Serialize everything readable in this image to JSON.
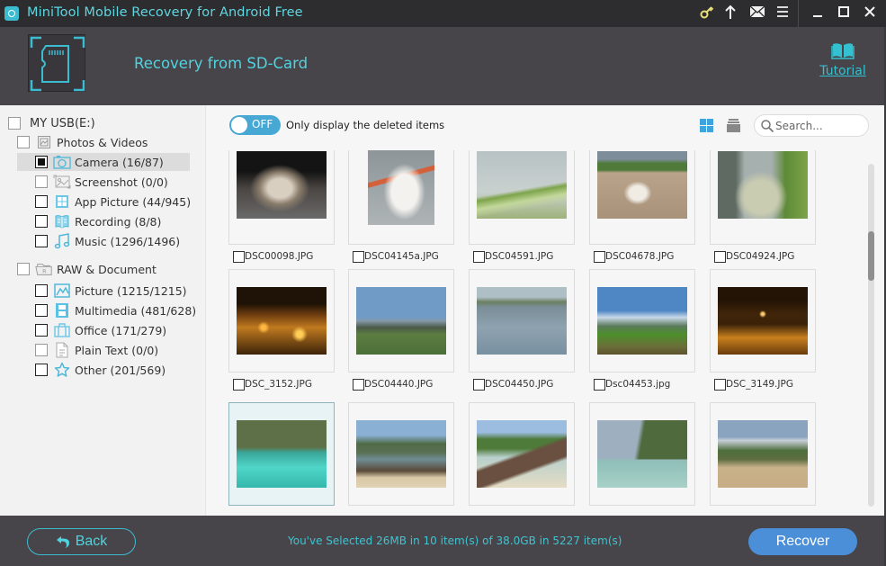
{
  "window": {
    "title": "MiniTool Mobile Recovery for Android Free",
    "icons": [
      "key-icon",
      "upgrade-arrow-icon",
      "mail-icon",
      "menu-icon",
      "minimize-icon",
      "maximize-icon",
      "close-icon"
    ]
  },
  "header": {
    "title": "Recovery from SD-Card",
    "tutorial_label": "Tutorial"
  },
  "sidebar": {
    "root": {
      "label": "MY USB(E:)",
      "checked": false
    },
    "groups": [
      {
        "label": "Photos & Videos",
        "icon": "photo-folder-icon",
        "items": [
          {
            "label": "Camera (16/87)",
            "icon": "camera-icon",
            "checked": true,
            "selected": true
          },
          {
            "label": "Screenshot (0/0)",
            "icon": "screenshot-icon",
            "checked": false,
            "disabled": true
          },
          {
            "label": "App Picture (44/945)",
            "icon": "app-picture-icon",
            "checked": false
          },
          {
            "label": "Recording (8/8)",
            "icon": "recording-icon",
            "checked": false
          },
          {
            "label": "Music (1296/1496)",
            "icon": "music-icon",
            "checked": false
          }
        ]
      },
      {
        "label": "RAW & Document",
        "icon": "raw-folder-icon",
        "items": [
          {
            "label": "Picture (1215/1215)",
            "icon": "picture-icon",
            "checked": false
          },
          {
            "label": "Multimedia (481/628)",
            "icon": "multimedia-icon",
            "checked": false
          },
          {
            "label": "Office (171/279)",
            "icon": "office-icon",
            "checked": false
          },
          {
            "label": "Plain Text (0/0)",
            "icon": "plain-text-icon",
            "checked": false,
            "disabled": true
          },
          {
            "label": "Other (201/569)",
            "icon": "other-star-icon",
            "checked": false
          }
        ]
      }
    ]
  },
  "toolbar": {
    "toggle_state": "OFF",
    "toggle_caption": "Only display the deleted items",
    "search_placeholder": "Search..."
  },
  "files": [
    {
      "name": "DSC00098.JPG",
      "thumb": "cat"
    },
    {
      "name": "DSC04145a.JPG",
      "thumb": "stork"
    },
    {
      "name": "DSC04591.JPG",
      "thumb": "dragonfly"
    },
    {
      "name": "DSC04678.JPG",
      "thumb": "dog-beach"
    },
    {
      "name": "DSC04924.JPG",
      "thumb": "butterfly"
    },
    {
      "name": "DSC_3152.JPG",
      "thumb": "city-night"
    },
    {
      "name": "DSC04440.JPG",
      "thumb": "mountain-field"
    },
    {
      "name": "DSC04450.JPG",
      "thumb": "lake"
    },
    {
      "name": "Dsc04453.jpg",
      "thumb": "green-hills"
    },
    {
      "name": "DSC_3149.JPG",
      "thumb": "city-night-2"
    },
    {
      "name": "",
      "thumb": "lagoon-boat",
      "selected": true
    },
    {
      "name": "",
      "thumb": "beach-cliffs"
    },
    {
      "name": "",
      "thumb": "longtail-boat"
    },
    {
      "name": "",
      "thumb": "bay-boats"
    },
    {
      "name": "",
      "thumb": "beach-sand"
    }
  ],
  "scroll": {
    "position_fraction": 0.23
  },
  "footer": {
    "back_label": "Back",
    "status": "You've Selected 26MB in 10 item(s) of 38.0GB in 5227 item(s)",
    "recover_label": "Recover"
  },
  "colors": {
    "accent": "#4fd3df",
    "recover_button": "#4a8fd8",
    "toggle": "#48a8d4",
    "chrome_dark": "#48454a"
  }
}
